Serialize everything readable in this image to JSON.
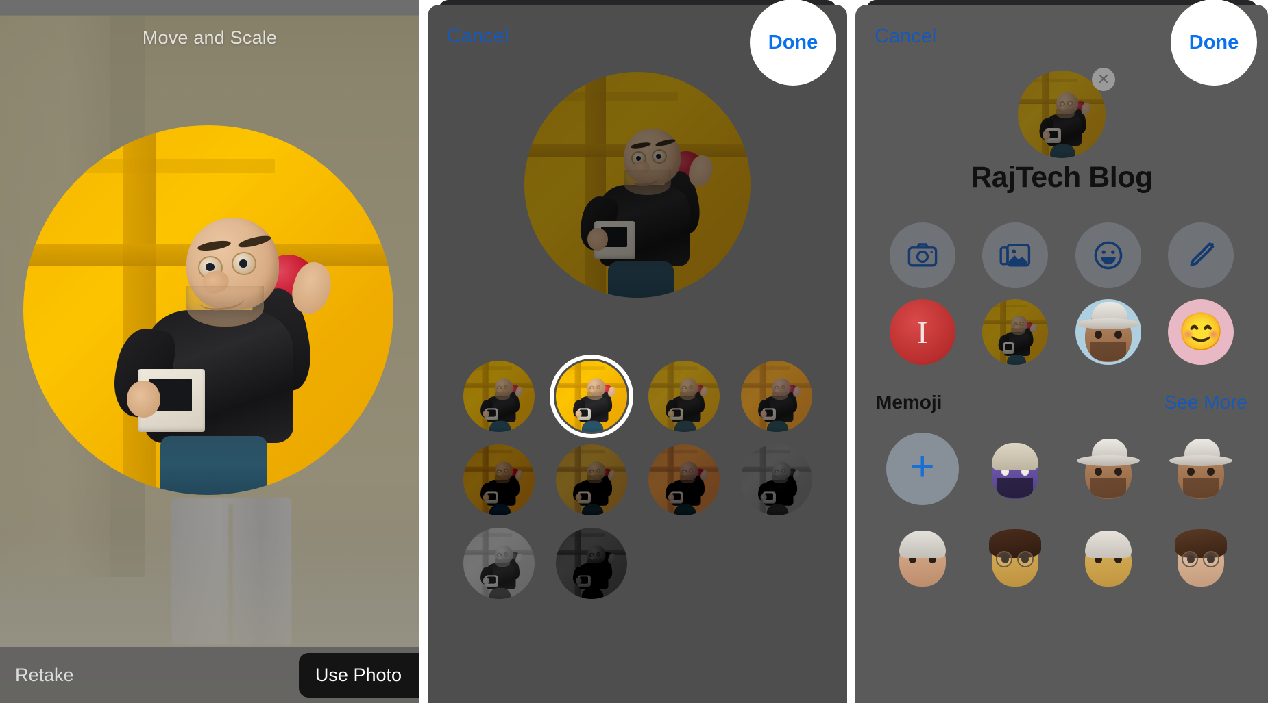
{
  "panel1": {
    "title": "Move and Scale",
    "retake_label": "Retake",
    "use_photo_label": "Use Photo"
  },
  "panel2": {
    "cancel_label": "Cancel",
    "done_label": "Done",
    "filters": [
      {
        "name": "Original",
        "class": "f-normal",
        "selected": false
      },
      {
        "name": "Vivid",
        "class": "f-vivid",
        "selected": true
      },
      {
        "name": "Vivid Warm",
        "class": "f-warm",
        "selected": false
      },
      {
        "name": "Vivid Cool",
        "class": "f-cool",
        "selected": false
      },
      {
        "name": "Dramatic",
        "class": "f-dramatic",
        "selected": false
      },
      {
        "name": "Dramatic Warm",
        "class": "f-dramwarm",
        "selected": false
      },
      {
        "name": "Dramatic Cool",
        "class": "f-dramcool",
        "selected": false
      },
      {
        "name": "Mono",
        "class": "f-mono",
        "selected": false
      },
      {
        "name": "Silvertone",
        "class": "f-silver",
        "selected": false
      },
      {
        "name": "Noir",
        "class": "f-noir",
        "selected": false
      }
    ]
  },
  "panel3": {
    "cancel_label": "Cancel",
    "done_label": "Done",
    "name": "RajTech Blog",
    "avatar_remove_glyph": "✕",
    "actions": [
      {
        "icon": "camera-icon",
        "label": "Camera"
      },
      {
        "icon": "photos-icon",
        "label": "Photos"
      },
      {
        "icon": "memoji-smiley-icon",
        "label": "Memoji"
      },
      {
        "icon": "pencil-icon",
        "label": "Draw"
      }
    ],
    "suggestions": [
      {
        "type": "monogram",
        "label": "I"
      },
      {
        "type": "photo",
        "label": "Photo"
      },
      {
        "type": "memoji",
        "label": "Cowboy Memoji"
      },
      {
        "type": "emoji",
        "label": "😊"
      }
    ],
    "memoji_section": {
      "title": "Memoji",
      "see_more_label": "See More",
      "add_glyph": "+",
      "items": [
        {
          "label": "Add Memoji",
          "type": "add"
        },
        {
          "label": "Purple Memoji",
          "type": "face",
          "glyph": "purple"
        },
        {
          "label": "Cowboy Memoji 1",
          "type": "face",
          "glyph": "cowboy"
        },
        {
          "label": "Cowboy Memoji 2",
          "type": "face",
          "glyph": "cowboy"
        },
        {
          "label": "Beanie Memoji",
          "type": "face",
          "glyph": "beanie-girl"
        },
        {
          "label": "Glasses Memoji",
          "type": "face",
          "glyph": "glasses-dark"
        },
        {
          "label": "Cap Memoji",
          "type": "face",
          "glyph": "cap"
        },
        {
          "label": "Glasses Memoji 2",
          "type": "face",
          "glyph": "glasses-light"
        }
      ]
    }
  },
  "colors": {
    "accent_blue": "#0a71ee",
    "link_blue": "#1a58b5",
    "sheet_gray": "#4e4e4e",
    "sheet_gray_light": "#5a5a5a",
    "photo_yellow": "#f5b600",
    "apple_red": "#c4152b"
  }
}
